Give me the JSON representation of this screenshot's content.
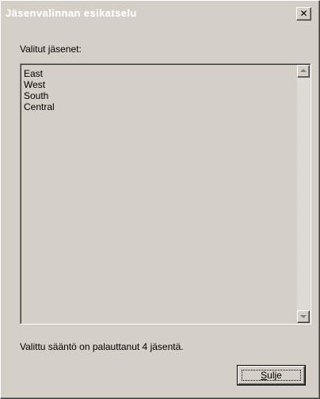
{
  "window": {
    "title": "Jäsenvalinnan esikatselu",
    "close_glyph": "✕"
  },
  "selected_members": {
    "label": "Valitut jäsenet:",
    "items": [
      "East",
      "West",
      "South",
      "Central"
    ]
  },
  "status": {
    "text": "Valittu sääntö on palauttanut 4 jäsentä."
  },
  "buttons": {
    "close_label_first": "S",
    "close_label_rest": "ulje"
  },
  "icons": {
    "scroll_up": "arrow-up-icon",
    "scroll_down": "arrow-down-icon",
    "close": "close-icon"
  }
}
